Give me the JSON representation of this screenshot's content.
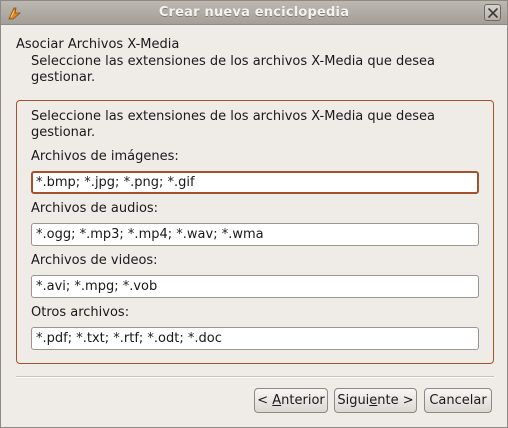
{
  "window": {
    "title": "Crear nueva enciclopedia",
    "icon": "app-logo-icon",
    "close_icon": "close-icon"
  },
  "header": {
    "title": "Asociar Archivos X-Media",
    "subtitle": "Seleccione las extensiones de los archivos X-Media que desea gestionar."
  },
  "frame": {
    "description": "Seleccione las extensiones de los archivos X-Media que desea gestionar.",
    "fields": [
      {
        "label": "Archivos de imágenes:",
        "value": "*.bmp; *.jpg; *.png; *.gif"
      },
      {
        "label": "Archivos de audios:",
        "value": "*.ogg; *.mp3; *.mp4; *.wav; *.wma"
      },
      {
        "label": "Archivos de videos:",
        "value": "*.avi; *.mpg; *.vob"
      },
      {
        "label": "Otros archivos:",
        "value": "*.pdf; *.txt; *.rtf; *.odt; *.doc"
      }
    ]
  },
  "buttons": {
    "back": {
      "prefix": "< ",
      "mnemonic": "A",
      "rest": "nterior"
    },
    "next": {
      "prefix": "Sigui",
      "mnemonic": "e",
      "rest": "nte >"
    },
    "cancel": "Cancelar"
  },
  "colors": {
    "accent": "#a4512e",
    "background": "#efebe7",
    "titlebar": "#b0aba5"
  }
}
